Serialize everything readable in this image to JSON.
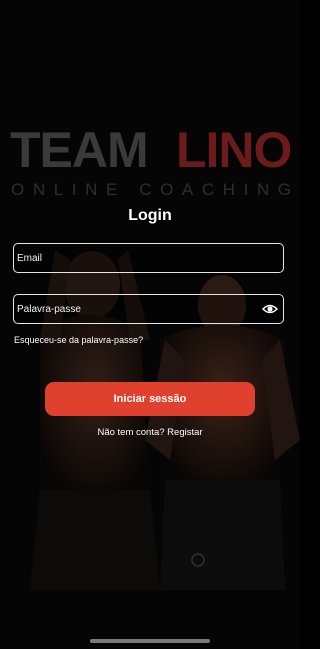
{
  "logo": {
    "team": "TEAM",
    "lino": "LINO",
    "subtitle": "ONLINE COACHING"
  },
  "login": {
    "title": "Login",
    "email_placeholder": "Email",
    "password_placeholder": "Palavra-passe",
    "forgot_label": "Esqueceu-se da palavra-passe?",
    "submit_label": "Iniciar sessão",
    "no_account_label": "Não tem conta?",
    "register_label": "Registar"
  },
  "icons": {
    "show_password": "eye-icon"
  },
  "colors": {
    "background": "#050505",
    "accent": "#e0412f",
    "logo_team": "#3a3a3a",
    "logo_lino": "#6b1b1b"
  }
}
